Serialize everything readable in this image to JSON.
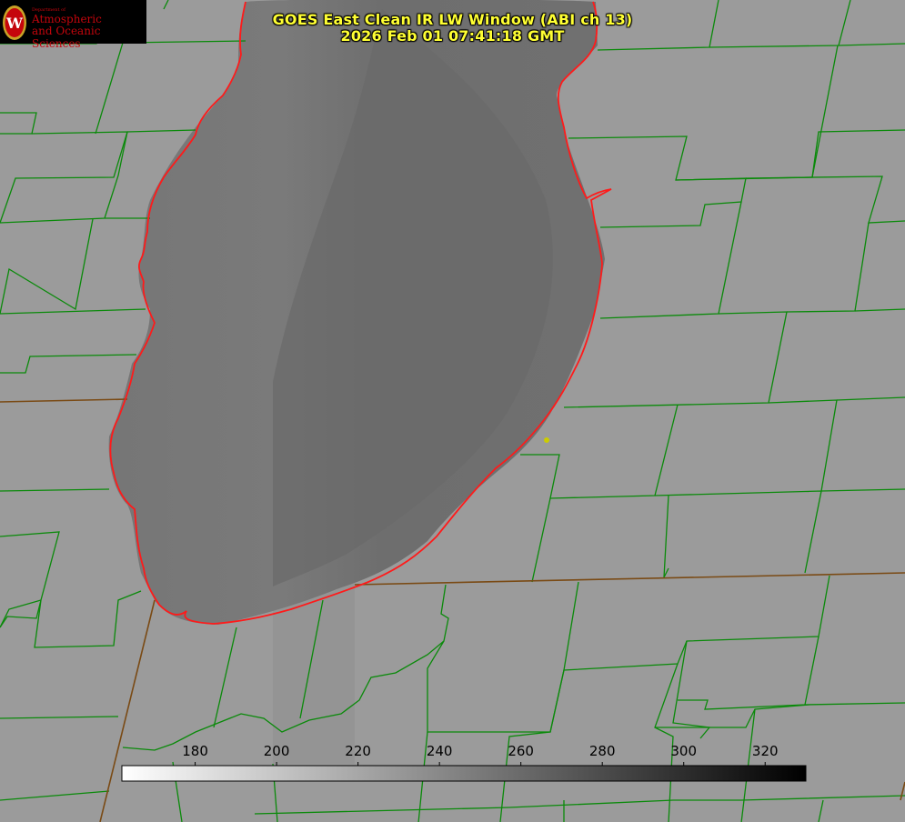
{
  "title": {
    "line1": "GOES East Clean IR LW Window (ABI ch 13)",
    "line2": "2026 Feb 01 07:41:18 GMT"
  },
  "logo": {
    "department": "Department of",
    "line1": "Atmospheric",
    "line2": "and Oceanic Sciences",
    "seal_letter": "W"
  },
  "colors": {
    "background": "#9a9a9a",
    "lake": "#6f6f6f",
    "county_lines": "#0a8a0a",
    "state_lines": "#8b3a0a",
    "coastline": "#ff1a1a",
    "title": "#ffff33",
    "point_marker": "#cccc00"
  },
  "colorbar": {
    "ticks": [
      180,
      200,
      220,
      240,
      260,
      280,
      300,
      320
    ],
    "min": 162,
    "max": 330,
    "gradient": "white-to-black"
  }
}
